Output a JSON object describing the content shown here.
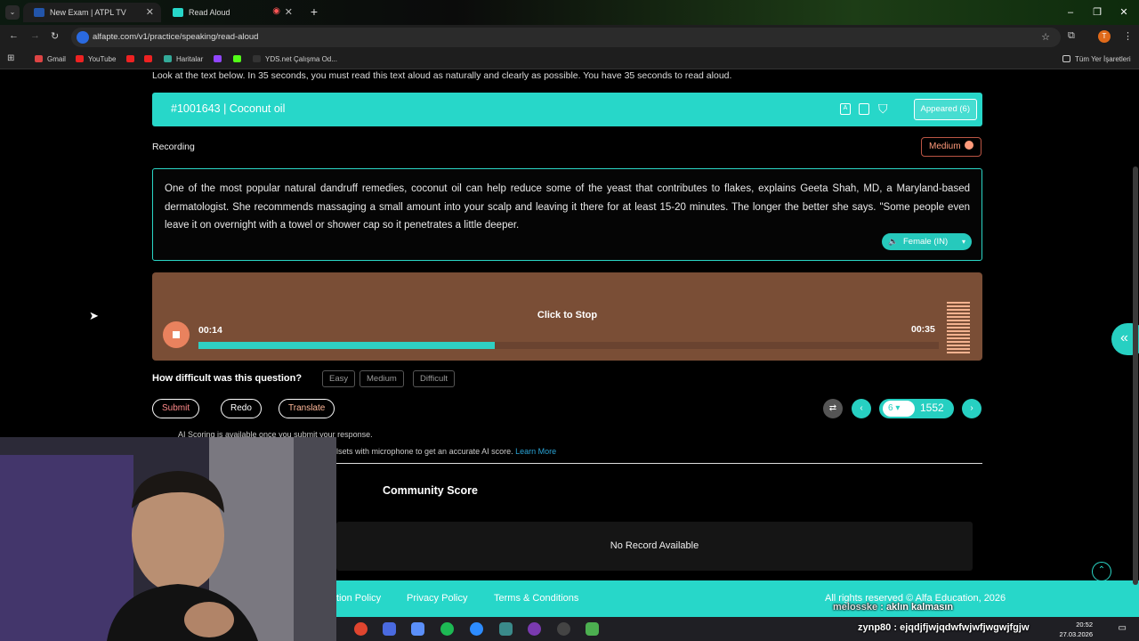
{
  "browser": {
    "tabs": [
      {
        "label": "New Exam | ATPL TV",
        "active": true
      },
      {
        "label": "Read Aloud",
        "active": false
      }
    ],
    "url": "alfapte.com/v1/practice/speaking/read-aloud",
    "bookmarks": [
      "Gmail",
      "YouTube",
      "Haritalar",
      "YDS.net Çalışma Od...",
      "Tüm Yer İşaretleri"
    ]
  },
  "page": {
    "instruction": "Look at the text below. In 35 seconds, you must read this text aloud as naturally and clearly as possible. You have 35 seconds to read aloud.",
    "question_title": "#1001643 | Coconut oil",
    "appeared": "Appeared (6)",
    "recording_label": "Recording",
    "difficulty_badge": "Medium",
    "passage": "One of the most popular natural dandruff remedies, coconut oil can help reduce some of the yeast that contributes to flakes, explains Geeta Shah, MD, a Maryland-based dermatologist. She recommends massaging a small amount into your scalp and leaving it there for at least 15-20 minutes. The longer the better she says. \"Some people even leave it on overnight with a towel or shower cap so it penetrates a little deeper.",
    "voice": "Female (IN)",
    "recorder": {
      "status": "Click to Stop",
      "elapsed": "00:14",
      "total": "00:35",
      "progress": 0.4
    },
    "difficulty_question": "How difficult was this question?",
    "difficulty_options": [
      "Easy",
      "Medium",
      "Difficult"
    ],
    "actions": {
      "submit": "Submit",
      "redo": "Redo",
      "translate": "Translate"
    },
    "pager": {
      "current": "6",
      "total": "1552"
    },
    "ai_note_1": "AI Scoring is available once you submit your response.",
    "ai_note_2": "lsets with microphone to get an accurate AI score.",
    "learn_more": "Learn More",
    "community_title": "Community Score",
    "no_record": "No Record Available",
    "footer": {
      "links": [
        "tion Policy",
        "Privacy Policy",
        "Terms & Conditions"
      ],
      "copyright": "All rights reserved © Alfa Education, 2026"
    }
  },
  "overlay": {
    "line1_user": "melosske",
    "line1_msg": "aklın kalmasın",
    "line2_user": "zynp80",
    "line2_msg": "ejqdjfjwjqdwfwjwfjwgwjfgjw"
  },
  "taskbar": {
    "time": "20:52",
    "date": "27.03.2026"
  },
  "colors": {
    "accent": "#27d7c9",
    "recorder_bg": "#7a4e36",
    "difficulty": "#ff9a7a"
  }
}
